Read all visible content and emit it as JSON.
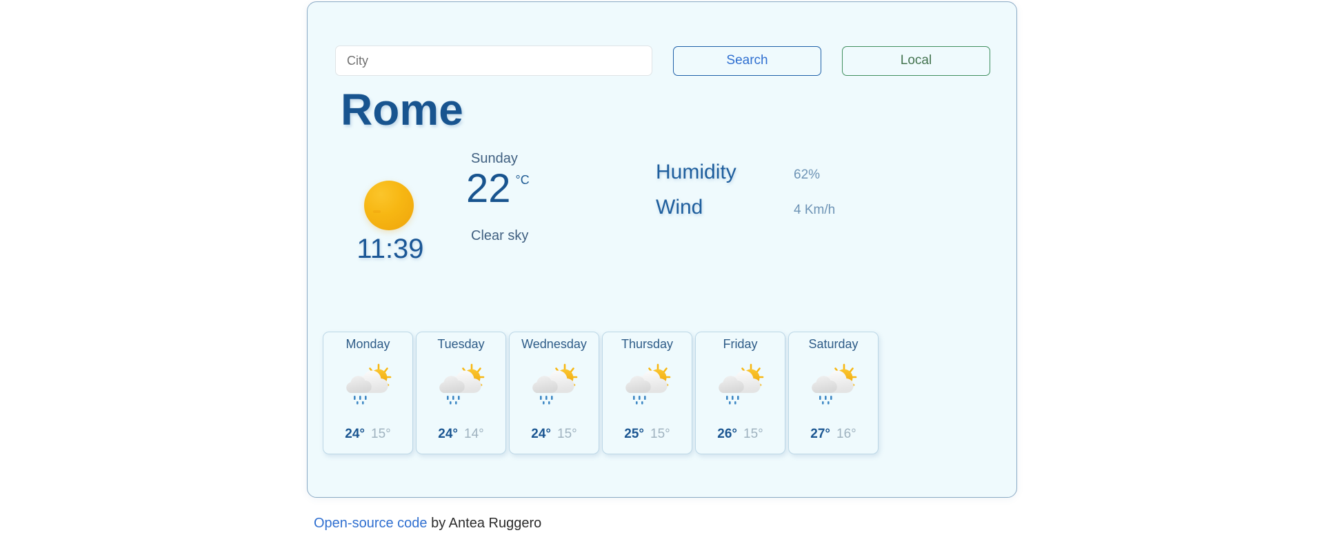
{
  "search": {
    "input_placeholder": "City",
    "input_value": "",
    "search_label": "Search",
    "local_label": "Local"
  },
  "current": {
    "city": "Rome",
    "local_time": "11:39",
    "weekday": "Sunday",
    "temperature": "22",
    "temperature_unit": "°C",
    "condition": "Clear sky",
    "condition_icon": "sun-icon",
    "humidity_label": "Humidity",
    "humidity_value": "62%",
    "wind_label": "Wind",
    "wind_value": "4 Km/h"
  },
  "forecast": [
    {
      "day": "Monday",
      "icon": "sun-behind-rain-cloud-icon",
      "max": "24°",
      "min": "15°"
    },
    {
      "day": "Tuesday",
      "icon": "sun-behind-rain-cloud-icon",
      "max": "24°",
      "min": "14°"
    },
    {
      "day": "Wednesday",
      "icon": "sun-behind-rain-cloud-icon",
      "max": "24°",
      "min": "15°"
    },
    {
      "day": "Thursday",
      "icon": "sun-behind-rain-cloud-icon",
      "max": "25°",
      "min": "15°"
    },
    {
      "day": "Friday",
      "icon": "sun-behind-rain-cloud-icon",
      "max": "26°",
      "min": "15°"
    },
    {
      "day": "Saturday",
      "icon": "sun-behind-rain-cloud-icon",
      "max": "27°",
      "min": "16°"
    }
  ],
  "footer": {
    "link_text": "Open-source code",
    "suffix_text": " by Antea Ruggero"
  },
  "colors": {
    "panel_bg": "#effafd",
    "panel_border": "#8aa9c4",
    "primary_blue": "#18548f",
    "link_blue": "#2f6fd0",
    "local_green": "#43734f",
    "muted_blue": "#6d93b5",
    "sun_yellow": "#f7b713",
    "rain_blue": "#3d87c4"
  }
}
